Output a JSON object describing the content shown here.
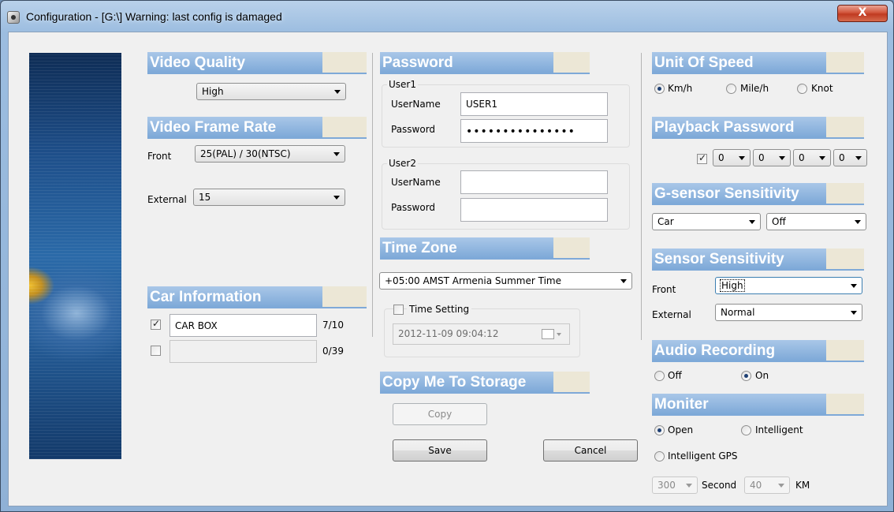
{
  "window": {
    "title": "Configuration - [G:\\] Warning: last config is damaged",
    "close_symbol": "X"
  },
  "video_quality": {
    "heading": "Video Quality",
    "value": "High"
  },
  "video_frame_rate": {
    "heading": "Video Frame Rate",
    "front_label": "Front",
    "front_value": "25(PAL) / 30(NTSC)",
    "external_label": "External",
    "external_value": "15"
  },
  "car_information": {
    "heading": "Car Information",
    "rows": [
      {
        "checked": true,
        "value": "CAR BOX",
        "count": "7/10"
      },
      {
        "checked": false,
        "value": "",
        "count": "0/39"
      }
    ]
  },
  "password": {
    "heading": "Password",
    "user1": {
      "group_label": "User1",
      "username_label": "UserName",
      "username_value": "USER1",
      "password_label": "Password",
      "password_value": "•••••••••••••••"
    },
    "user2": {
      "group_label": "User2",
      "username_label": "UserName",
      "username_value": "",
      "password_label": "Password",
      "password_value": ""
    }
  },
  "time_zone": {
    "heading": "Time Zone",
    "value": "+05:00 AMST Armenia Summer Time",
    "time_setting_label": "Time Setting",
    "time_setting_checked": false,
    "datetime_value": "2012-11-09 09:04:12"
  },
  "copy_to_storage": {
    "heading": "Copy Me To Storage",
    "copy_label": "Copy"
  },
  "footer": {
    "save_label": "Save",
    "cancel_label": "Cancel"
  },
  "unit_of_speed": {
    "heading": "Unit Of Speed",
    "options": [
      "Km/h",
      "Mile/h",
      "Knot"
    ],
    "selected": "Km/h"
  },
  "playback_password": {
    "heading": "Playback Password",
    "enabled": true,
    "digits": [
      "0",
      "0",
      "0",
      "0"
    ]
  },
  "g_sensor": {
    "heading": "G-sensor Sensitivity",
    "vehicle_value": "Car",
    "level_value": "Off"
  },
  "sensor_sensitivity": {
    "heading": "Sensor Sensitivity",
    "front_label": "Front",
    "front_value": "High",
    "external_label": "External",
    "external_value": "Normal"
  },
  "audio_recording": {
    "heading": "Audio Recording",
    "options": [
      "Off",
      "On"
    ],
    "selected": "On"
  },
  "moniter": {
    "heading": "Moniter",
    "options": [
      "Open",
      "Intelligent",
      "Intelligent GPS"
    ],
    "selected": "Open",
    "seconds_value": "300",
    "seconds_label": "Second",
    "km_value": "40",
    "km_label": "KM"
  },
  "colors": {
    "header_blue": "#7ea9d8",
    "header_tail": "#ece7d6",
    "window_bg": "#f0f0f0",
    "close_red": "#c03a20"
  }
}
